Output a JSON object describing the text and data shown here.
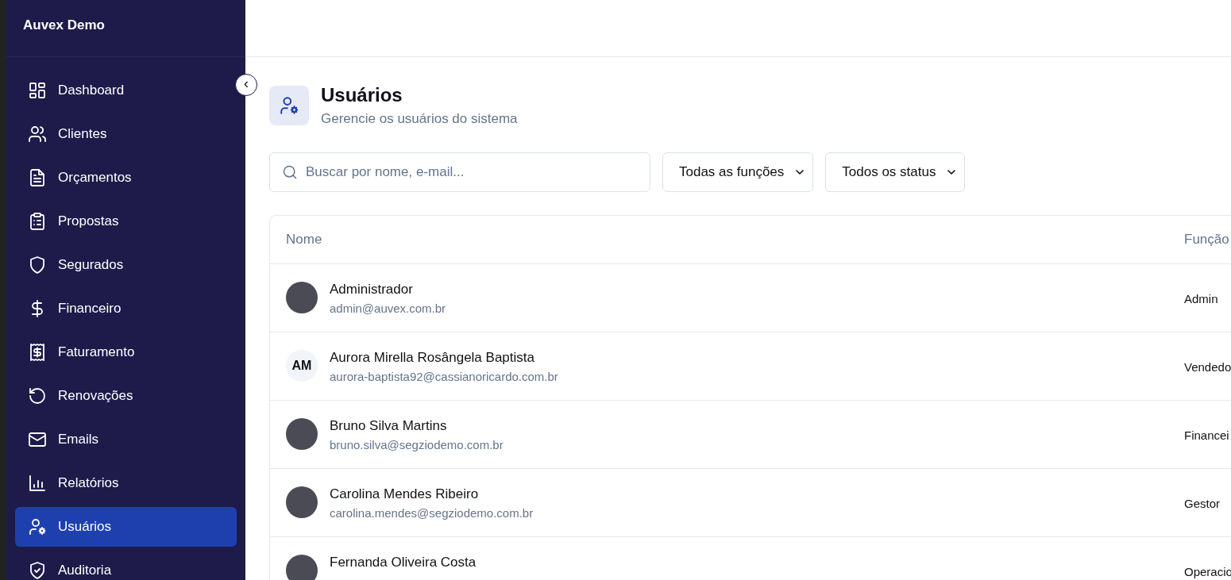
{
  "sidebar": {
    "brand": "Auvex Demo",
    "collapse_icon": "‹",
    "items": [
      {
        "label": "Dashboard",
        "selected": false
      },
      {
        "label": "Clientes",
        "selected": false
      },
      {
        "label": "Orçamentos",
        "selected": false
      },
      {
        "label": "Propostas",
        "selected": false
      },
      {
        "label": "Segurados",
        "selected": false
      },
      {
        "label": "Financeiro",
        "selected": false
      },
      {
        "label": "Faturamento",
        "selected": false
      },
      {
        "label": "Renovações",
        "selected": false
      },
      {
        "label": "Emails",
        "selected": false
      },
      {
        "label": "Relatórios",
        "selected": false
      },
      {
        "label": "Usuários",
        "selected": true
      },
      {
        "label": "Auditoria",
        "selected": false
      }
    ]
  },
  "page_header": {
    "title": "Usuários",
    "subtitle": "Gerencie os usuários do sistema"
  },
  "filters": {
    "search": {
      "placeholder": "Buscar por nome, e-mail..."
    },
    "selects": [
      "Todas as funções",
      "Todos os status"
    ]
  },
  "table": {
    "columns": [
      "Nome",
      "Função"
    ],
    "rows": [
      {
        "name": "Administrador",
        "email": "admin@auvex.com.br",
        "role": "Admin",
        "avatar": {
          "kind": "photo"
        }
      },
      {
        "name": "Aurora Mirella Rosângela Baptista",
        "email": "aurora-baptista92@cassianoricardo.com.br",
        "role": "Vendedo",
        "avatar": {
          "kind": "initials",
          "text": "AM"
        }
      },
      {
        "name": "Bruno Silva Martins",
        "email": "bruno.silva@segziodemo.com.br",
        "role": "Financei",
        "avatar": {
          "kind": "photo"
        }
      },
      {
        "name": "Carolina Mendes Ribeiro",
        "email": "carolina.mendes@segziodemo.com.br",
        "role": "Gestor",
        "avatar": {
          "kind": "photo"
        }
      },
      {
        "name": "Fernanda Oliveira Costa",
        "role": "Operacio",
        "avatar": {
          "kind": "photo"
        }
      }
    ]
  }
}
